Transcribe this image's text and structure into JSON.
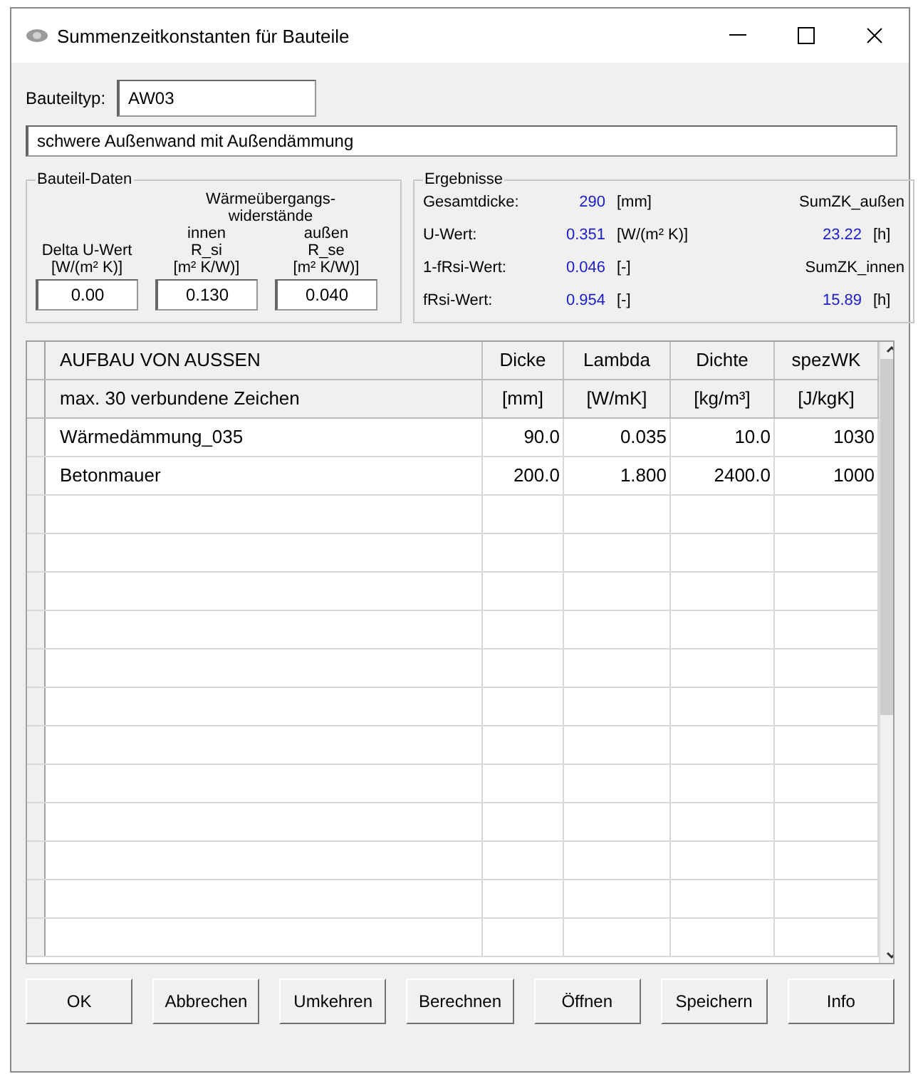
{
  "window": {
    "title": "Summenzeitkonstanten für Bauteile"
  },
  "type_field": {
    "label": "Bauteiltyp:",
    "value": "AW03"
  },
  "description": {
    "value": "schwere Außenwand mit Außendämmung"
  },
  "component_data": {
    "title": "Bauteil-Daten",
    "heading_lines": [
      "Wärmeübergangs-",
      "widerstände"
    ],
    "fields": [
      {
        "caption_lines": [
          "Delta U-Wert",
          "[W/(m² K)]"
        ],
        "value": "0.00"
      },
      {
        "side": "innen",
        "caption_lines": [
          "R_si",
          "[m² K/W)]"
        ],
        "value": "0.130"
      },
      {
        "side": "außen",
        "caption_lines": [
          "R_se",
          "[m² K/W)]"
        ],
        "value": "0.040"
      }
    ]
  },
  "results": {
    "title": "Ergebnisse",
    "rows": [
      {
        "label": "Gesamtdicke:",
        "value": "290",
        "unit": "[mm]",
        "right_label": "SumZK_außen"
      },
      {
        "label": "U-Wert:",
        "value": "0.351",
        "unit": "[W/(m² K)]",
        "right_value": "23.22",
        "right_unit": "[h]"
      },
      {
        "label": "1-fRsi-Wert:",
        "value": "0.046",
        "unit": "[-]",
        "right_label": "SumZK_innen"
      },
      {
        "label": "fRsi-Wert:",
        "value": "0.954",
        "unit": "[-]",
        "right_value": "15.89",
        "right_unit": "[h]"
      }
    ]
  },
  "table": {
    "columns": [
      {
        "title": "AUFBAU VON AUSSEN",
        "unit": "max. 30 verbundene Zeichen"
      },
      {
        "title": "Dicke",
        "unit": "[mm]"
      },
      {
        "title": "Lambda",
        "unit": "[W/mK]"
      },
      {
        "title": "Dichte",
        "unit": "[kg/m³]"
      },
      {
        "title": "spezWK",
        "unit": "[J/kgK]"
      }
    ],
    "rows": [
      [
        "Wärmedämmung_035",
        "90.0",
        "0.035",
        "10.0",
        "1030"
      ],
      [
        "Betonmauer",
        "200.0",
        "1.800",
        "2400.0",
        "1000"
      ]
    ]
  },
  "buttons": [
    "OK",
    "Abbrechen",
    "Umkehren",
    "Berechnen",
    "Öffnen",
    "Speichern",
    "Info"
  ]
}
